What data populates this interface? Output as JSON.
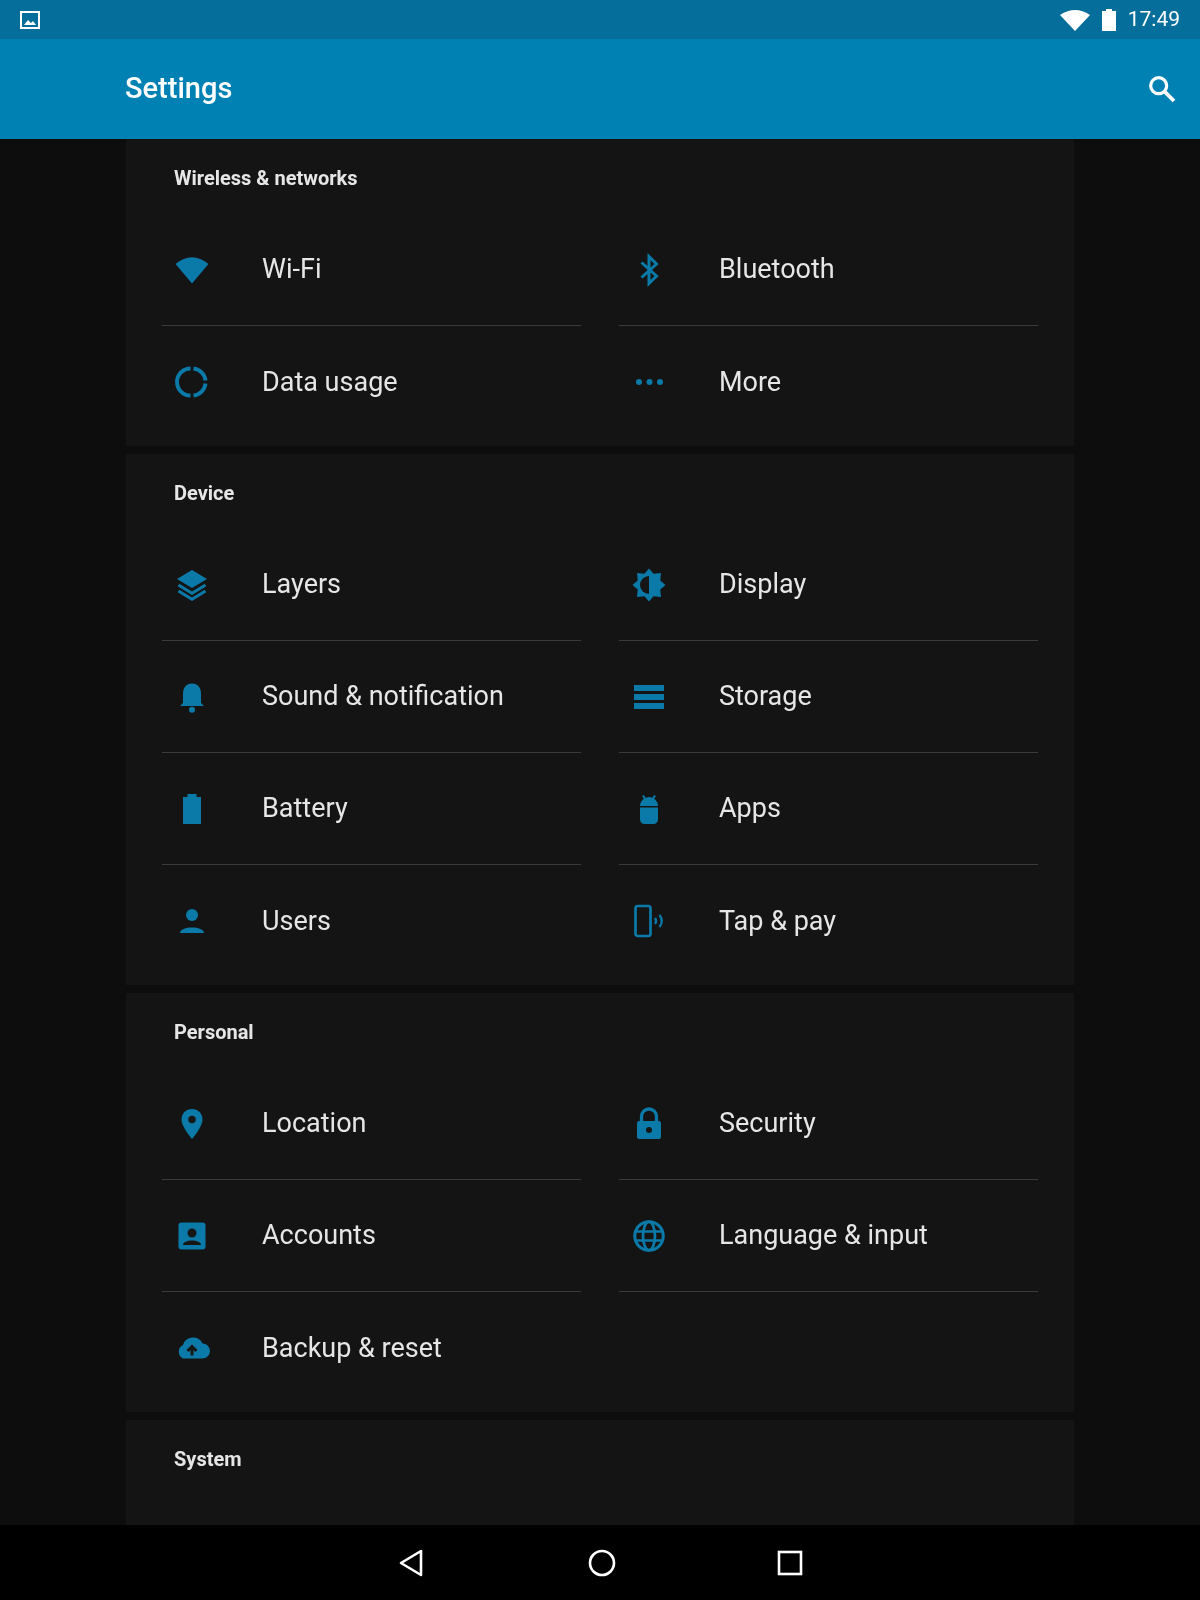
{
  "status_bar": {
    "time": "17:49"
  },
  "app_bar": {
    "title": "Settings"
  },
  "sections": [
    {
      "title": "Wireless & networks",
      "items": [
        {
          "label": "Wi-Fi",
          "kind": "wifi"
        },
        {
          "label": "Bluetooth",
          "kind": "bluetooth"
        },
        {
          "label": "Data usage",
          "kind": "data"
        },
        {
          "label": "More",
          "kind": "more"
        }
      ]
    },
    {
      "title": "Device",
      "items": [
        {
          "label": "Layers",
          "kind": "layers"
        },
        {
          "label": "Display",
          "kind": "display"
        },
        {
          "label": "Sound & notification",
          "kind": "bell"
        },
        {
          "label": "Storage",
          "kind": "storage"
        },
        {
          "label": "Battery",
          "kind": "battery"
        },
        {
          "label": "Apps",
          "kind": "android"
        },
        {
          "label": "Users",
          "kind": "person"
        },
        {
          "label": "Tap & pay",
          "kind": "tap"
        }
      ]
    },
    {
      "title": "Personal",
      "items": [
        {
          "label": "Location",
          "kind": "pin"
        },
        {
          "label": "Security",
          "kind": "lock"
        },
        {
          "label": "Accounts",
          "kind": "account"
        },
        {
          "label": "Language & input",
          "kind": "globe"
        },
        {
          "label": "Backup & reset",
          "kind": "cloud"
        }
      ]
    },
    {
      "title": "System"
    }
  ]
}
